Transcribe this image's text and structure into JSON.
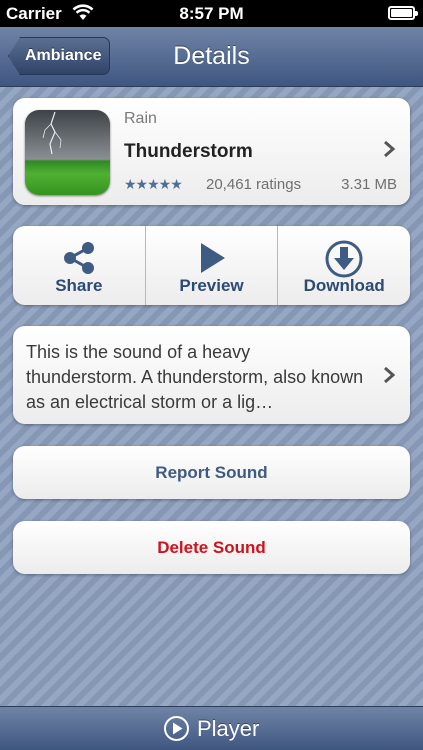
{
  "status_bar": {
    "carrier": "Carrier",
    "time": "8:57 PM"
  },
  "nav": {
    "back_label": "Ambiance",
    "title": "Details"
  },
  "sound": {
    "category": "Rain",
    "name": "Thunderstorm",
    "rating_stars": 4.5,
    "stars_glyph": "★★★★★",
    "ratings_text": "20,461 ratings",
    "size": "3.31 MB",
    "description": "This is the sound of a heavy thunderstorm. A thunderstorm, also known as an electrical storm or a lig…"
  },
  "actions": [
    {
      "label": "Share",
      "icon": "share-icon"
    },
    {
      "label": "Preview",
      "icon": "play-icon"
    },
    {
      "label": "Download",
      "icon": "download-icon"
    }
  ],
  "buttons": {
    "report": "Report Sound",
    "delete": "Delete Sound"
  },
  "bottom_bar": {
    "player_label": "Player",
    "icon": "play-circle-icon"
  },
  "colors": {
    "accent": "#2d4a74",
    "delete": "#d0121d",
    "navbar": "#4f6590"
  }
}
